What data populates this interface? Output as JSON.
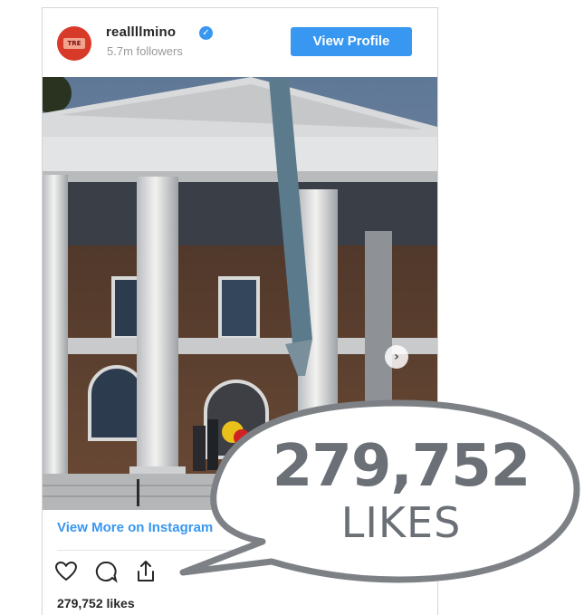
{
  "post": {
    "username": "reallllmino",
    "followers": "5.7m followers",
    "view_profile_label": "View Profile",
    "view_more_label": "View More on Instagram",
    "likes_line": "279,752 likes"
  },
  "callout": {
    "number": "279,752",
    "word": "LIKES"
  },
  "icons": [
    "heart-icon",
    "comment-icon",
    "share-icon",
    "verified-badge-icon",
    "chevron-right-icon"
  ],
  "colors": {
    "accent": "#3897f0",
    "bubble_border": "#7d8186",
    "callout_text": "#6b7077"
  }
}
